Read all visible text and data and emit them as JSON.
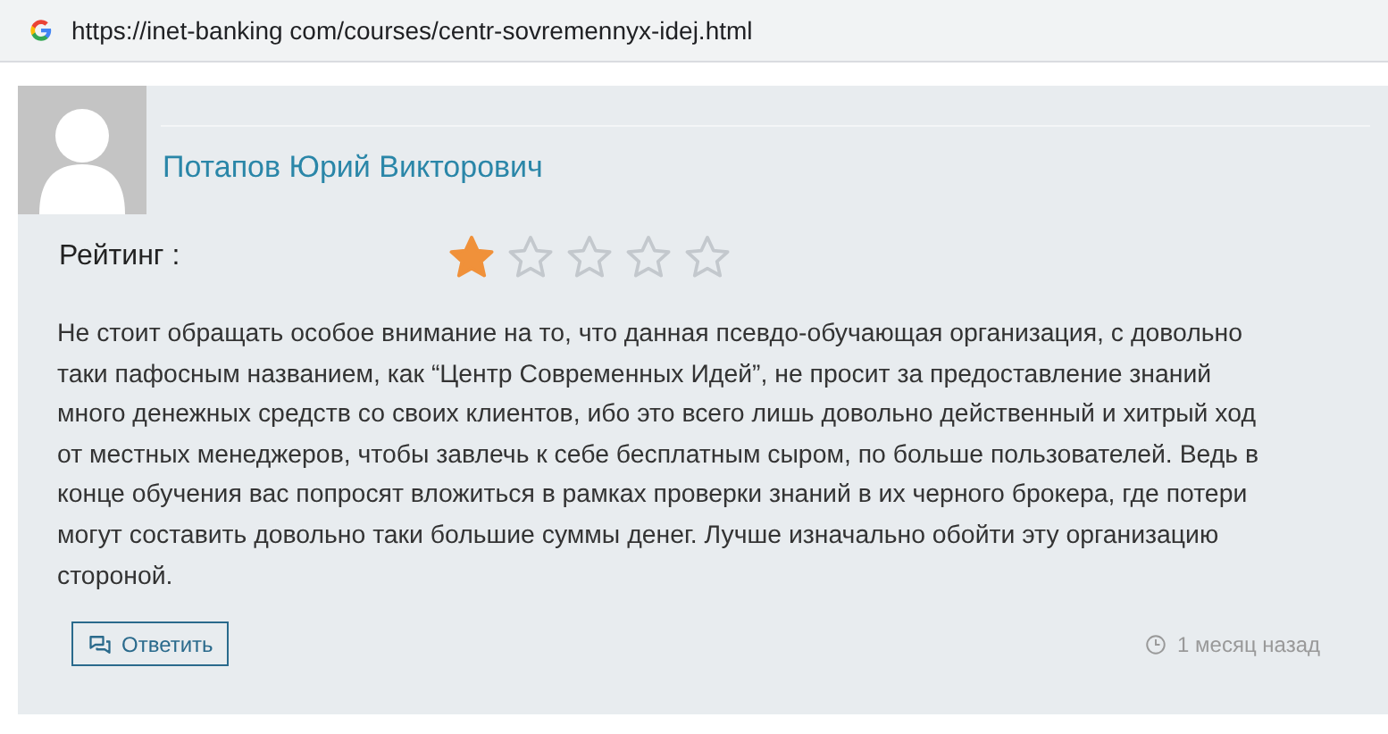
{
  "address_bar": {
    "url": "https://inet-banking com/courses/centr-sovremennyx-idej.html"
  },
  "review": {
    "author": "Потапов Юрий Викторович",
    "rating_label": "Рейтинг :",
    "stars": 1,
    "text": "Не стоит обращать особое внимание на то, что данная псевдо-обучающая организация, с довольно таки пафосным названием, как “Центр Современных Идей”, не просит за предоставление знаний много денежных средств со своих клиентов, ибо это всего лишь довольно действенный и хитрый ход от местных менеджеров, чтобы завлечь к себе бесплатным сыром, по больше пользователей. Ведь в конце обучения вас попросят вложиться в рамках проверки знаний в их черного брокера, где потери могут составить довольно таки большие суммы денег. Лучше изначально обойти эту организацию стороной.",
    "reply_button": "Ответить",
    "time": "1 месяц назад"
  }
}
